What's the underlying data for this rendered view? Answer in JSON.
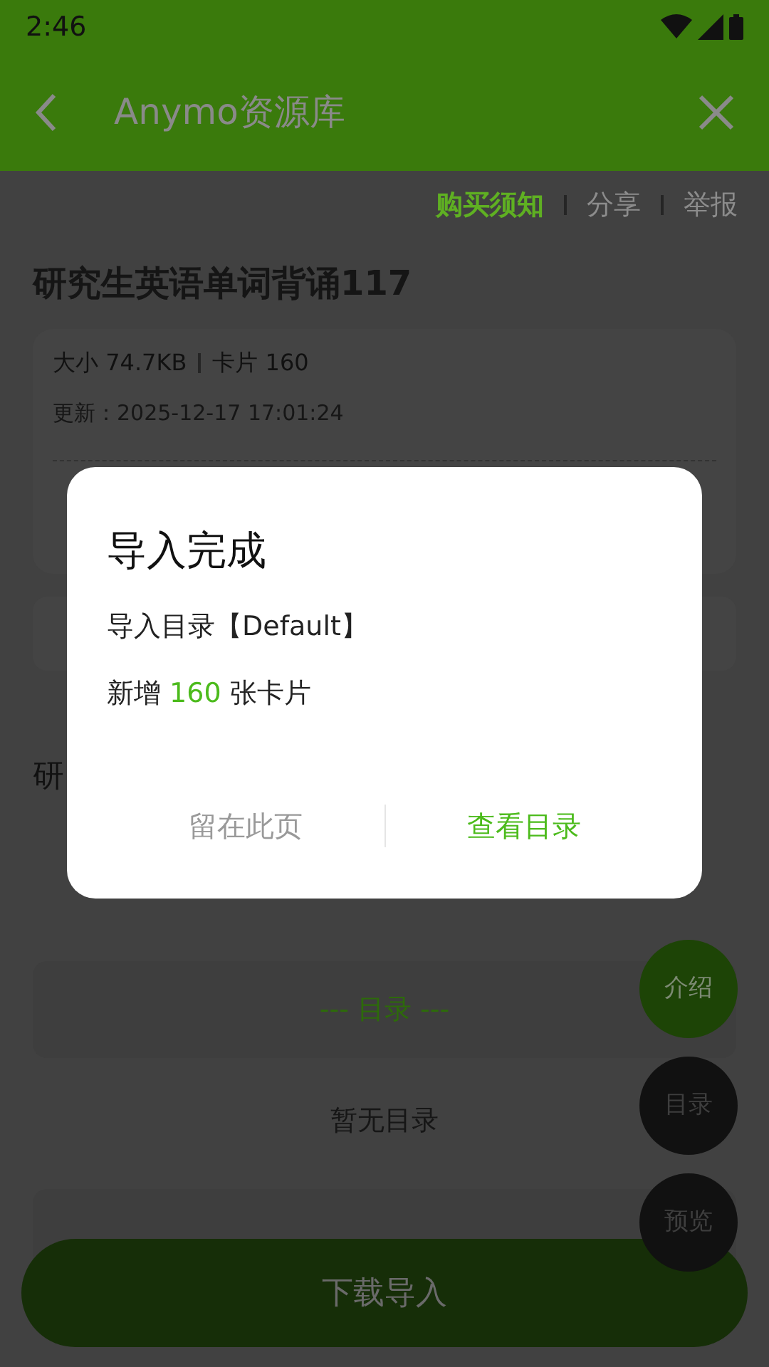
{
  "status_bar": {
    "time": "2:46"
  },
  "header": {
    "title": "Anymo资源库"
  },
  "links": [
    {
      "label": "购买须知",
      "kind": "emphasis"
    },
    {
      "label": "分享",
      "kind": "plain"
    },
    {
      "label": "举报",
      "kind": "plain"
    }
  ],
  "resource": {
    "title": "研究生英语单词背诵117",
    "size": "大小 74.7KB",
    "cards": "卡片 160",
    "updated": "更新：2025-12-17 17:01:24"
  },
  "partial_text": "研",
  "catalog": {
    "heading": "--- 目录 ---",
    "empty": "暂无目录"
  },
  "download_button": "下载导入",
  "fabs": [
    {
      "label": "介绍",
      "selected": true
    },
    {
      "label": "目录",
      "selected": false
    },
    {
      "label": "预览",
      "selected": false
    }
  ],
  "dialog": {
    "title": "导入完成",
    "folder_line": "导入目录【Default】",
    "added": {
      "prefix": "新增",
      "count": "160",
      "suffix": "张卡片"
    },
    "buttons": [
      {
        "label": "留在此页",
        "kind": "secondary"
      },
      {
        "label": "查看目录",
        "kind": "primary"
      }
    ]
  }
}
